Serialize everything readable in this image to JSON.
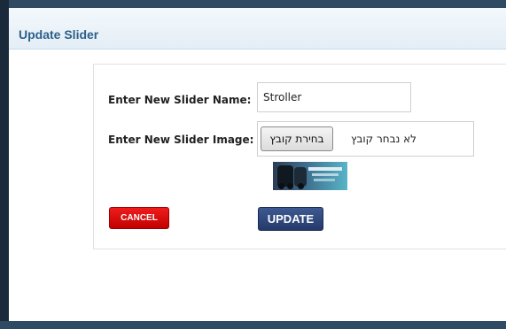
{
  "header": {
    "title": "Update Slider"
  },
  "form": {
    "name_label": "Enter New Slider Name:",
    "name_value": "Stroller",
    "image_label": "Enter New Slider Image:",
    "file_button_label": "בחירת קובץ",
    "file_status": "לא נבחר קובץ"
  },
  "buttons": {
    "cancel_label": "CANCEL",
    "update_label": "UPDATE"
  },
  "colors": {
    "header_text": "#2d5f8a",
    "cancel_bg": "#d90000",
    "update_bg": "#2e4679",
    "frame_dark": "#2f4a63"
  }
}
